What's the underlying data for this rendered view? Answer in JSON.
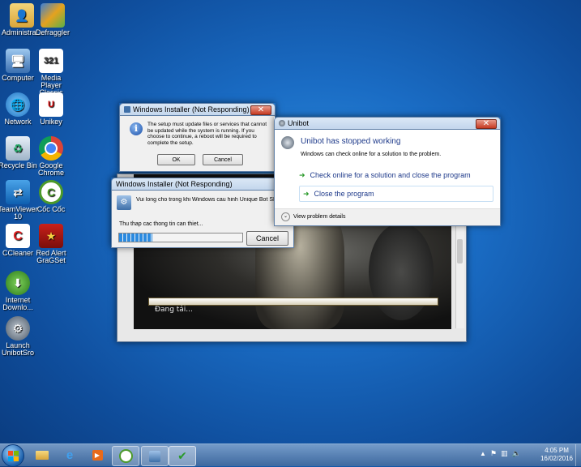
{
  "desktop": {
    "icons": [
      {
        "label": "Administra..."
      },
      {
        "label": "Defraggler"
      },
      {
        "label": "Computer"
      },
      {
        "label": "Media Player Classic"
      },
      {
        "label": "Network"
      },
      {
        "label": "Unikey"
      },
      {
        "label": "Recycle Bin"
      },
      {
        "label": "Google Chrome"
      },
      {
        "label": "TeamViewer 10"
      },
      {
        "label": "Cốc Cốc"
      },
      {
        "label": "CCleaner"
      },
      {
        "label": "Red Alert GraGSet"
      },
      {
        "label": "Internet Downlo..."
      },
      {
        "label": "Launch UnibotSro"
      }
    ]
  },
  "installer_prompt": {
    "title": "Windows Installer (Not Responding)",
    "message": "The setup must update files or services that cannot be updated while the system is running. If you choose to continue, a reboot will be required to complete the setup.",
    "ok_label": "OK",
    "cancel_label": "Cancel"
  },
  "installer_progress": {
    "title": "Windows Installer (Not Responding)",
    "message": "Vui long cho trong khi Windows cau hinh Unique Bot SRO VDC",
    "status": "Thu thap cac thong tin can thiet...",
    "cancel_label": "Cancel",
    "progress_fraction": 0.27
  },
  "loader": {
    "loading_text": "Đang tải..."
  },
  "crash_dialog": {
    "title": "Unibot",
    "heading": "Unibot has stopped working",
    "subtext": "Windows can check online for a solution to the problem.",
    "option1": "Check online for a solution and close the program",
    "option2": "Close the program",
    "details_label": "View problem details"
  },
  "taskbar": {
    "time": "4:05 PM",
    "date": "16/02/2016"
  }
}
